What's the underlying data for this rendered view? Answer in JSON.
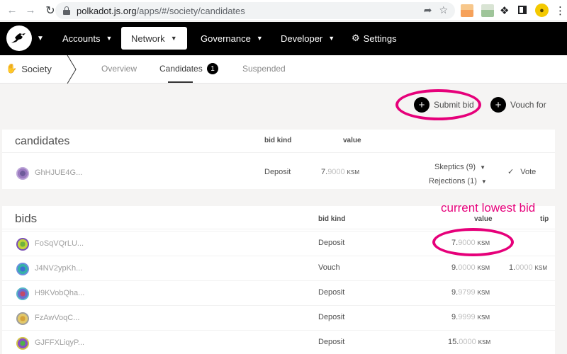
{
  "browser": {
    "url_domain": "polkadot.js.org",
    "url_path": "/apps/#/society/candidates",
    "icons": [
      "back-arrow-icon",
      "forward-arrow-icon",
      "reload-icon",
      "lock-icon",
      "share-icon",
      "star-icon",
      "puzzle-icon",
      "profile-icon",
      "kebab-icon"
    ]
  },
  "nav": {
    "items": [
      {
        "label": "Accounts"
      },
      {
        "label": "Network"
      },
      {
        "label": "Governance"
      },
      {
        "label": "Developer"
      },
      {
        "label": "Settings"
      }
    ]
  },
  "subnav": {
    "section": "Society",
    "tabs": [
      {
        "label": "Overview"
      },
      {
        "label": "Candidates",
        "badge": "1"
      },
      {
        "label": "Suspended"
      }
    ]
  },
  "actions": {
    "submit_bid": "Submit bid",
    "vouch_for": "Vouch for"
  },
  "candidates": {
    "title": "candidates",
    "headers": {
      "kind": "bid kind",
      "value": "value"
    },
    "rows": [
      {
        "address": "GhHJUE4G...",
        "kind": "Deposit",
        "value_int": "7.",
        "value_frac": "9000",
        "unit": "KSM",
        "skeptics": "Skeptics (9)",
        "rejections": "Rejections (1)",
        "vote": "Vote"
      }
    ]
  },
  "bids": {
    "title": "bids",
    "headers": {
      "kind": "bid kind",
      "value": "value",
      "tip": "tip"
    },
    "annotation": "current lowest bid",
    "rows": [
      {
        "address": "FoSqVQrLU...",
        "kind": "Deposit",
        "value_int": "7.",
        "value_frac": "9000",
        "unit": "KSM",
        "tip_int": "",
        "tip_frac": "",
        "tip_unit": ""
      },
      {
        "address": "J4NV2ypKh...",
        "kind": "Vouch",
        "value_int": "9.",
        "value_frac": "0000",
        "unit": "KSM",
        "tip_int": "1.",
        "tip_frac": "0000",
        "tip_unit": "KSM"
      },
      {
        "address": "H9KVobQha...",
        "kind": "Deposit",
        "value_int": "9.",
        "value_frac": "9799",
        "unit": "KSM",
        "tip_int": "",
        "tip_frac": "",
        "tip_unit": ""
      },
      {
        "address": "FzAwVoqC...",
        "kind": "Deposit",
        "value_int": "9.",
        "value_frac": "9999",
        "unit": "KSM",
        "tip_int": "",
        "tip_frac": "",
        "tip_unit": ""
      },
      {
        "address": "GJFFXLiqyP...",
        "kind": "Deposit",
        "value_int": "15.",
        "value_frac": "0000",
        "unit": "KSM",
        "tip_int": "",
        "tip_frac": "",
        "tip_unit": ""
      }
    ]
  },
  "colors": {
    "accent": "#e6007a",
    "navbar": "#000000"
  }
}
